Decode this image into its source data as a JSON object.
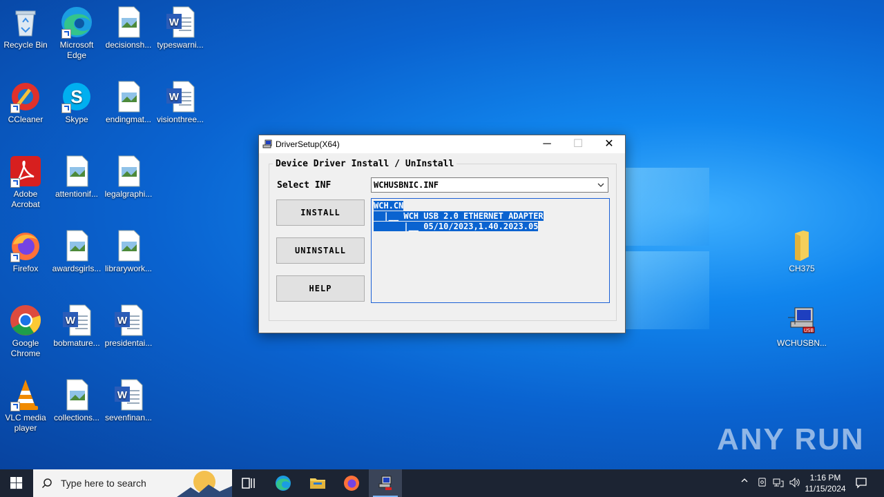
{
  "desktop": {
    "icons": [
      {
        "label": "Recycle Bin",
        "icon": "recycle-bin-icon"
      },
      {
        "label": "Microsoft Edge",
        "icon": "edge-icon"
      },
      {
        "label": "decisionsh...",
        "icon": "image-file-icon"
      },
      {
        "label": "typeswarni...",
        "icon": "word-file-icon"
      },
      {
        "label": "CCleaner",
        "icon": "ccleaner-icon"
      },
      {
        "label": "Skype",
        "icon": "skype-icon"
      },
      {
        "label": "endingmat...",
        "icon": "image-file-icon"
      },
      {
        "label": "visionthree...",
        "icon": "word-file-icon"
      },
      {
        "label": "Adobe Acrobat",
        "icon": "acrobat-icon"
      },
      {
        "label": "attentionif...",
        "icon": "image-file-icon"
      },
      {
        "label": "legalgraphi...",
        "icon": "image-file-icon"
      },
      {
        "label": "Firefox",
        "icon": "firefox-icon"
      },
      {
        "label": "awardsgirls...",
        "icon": "image-file-icon"
      },
      {
        "label": "librarywork...",
        "icon": "image-file-icon"
      },
      {
        "label": "Google Chrome",
        "icon": "chrome-icon"
      },
      {
        "label": "bobmature...",
        "icon": "word-file-icon"
      },
      {
        "label": "presidentai...",
        "icon": "word-file-icon"
      },
      {
        "label": "VLC media player",
        "icon": "vlc-icon"
      },
      {
        "label": "collections...",
        "icon": "image-file-icon"
      },
      {
        "label": "sevenfinan...",
        "icon": "word-file-icon"
      },
      {
        "label": "CH375",
        "icon": "folder-icon"
      },
      {
        "label": "WCHUSBN...",
        "icon": "setup-program-icon"
      }
    ]
  },
  "dialog": {
    "title": "DriverSetup(X64)",
    "group_title": "Device Driver Install / UnInstall",
    "select_label": "Select INF",
    "select_value": "WCHUSBNIC.INF",
    "buttons": {
      "install": "INSTALL",
      "uninstall": "UNINSTALL",
      "help": "HELP"
    },
    "tree_lines": [
      "WCH.CN",
      "  |__ WCH USB 2.0 ETHERNET ADAPTER",
      "      |__ 05/10/2023,1.40.2023.05"
    ],
    "minimize": "─",
    "maximize": "☐",
    "close": "✕"
  },
  "taskbar": {
    "search_placeholder": "Type here to search",
    "time": "1:16 PM",
    "date": "11/15/2024"
  },
  "watermark": "ANY RUN",
  "colors": {
    "accent": "#0a63d0",
    "taskbar": "#1c2433",
    "desktop": "#0a63d0"
  }
}
